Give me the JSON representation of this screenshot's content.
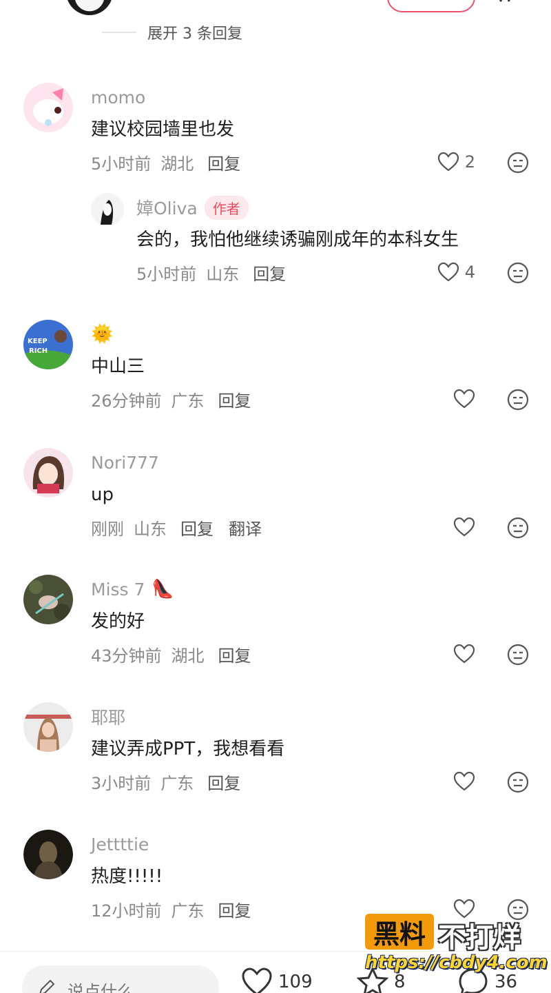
{
  "header": {
    "expand_replies": "展开 3 条回复"
  },
  "comments": [
    {
      "name": "momo",
      "text": "建议校园墙里也发",
      "time": "5小时前",
      "region": "湖北",
      "reply": "回复",
      "likes": "2"
    },
    {
      "name": "嫜Oliva",
      "author_tag": "作者",
      "text": "会的，我怕他继续诱骗刚成年的本科女生",
      "time": "5小时前",
      "region": "山东",
      "reply": "回复",
      "likes": "4"
    },
    {
      "name_emoji": "🌞",
      "text": "中山三",
      "time": "26分钟前",
      "region": "广东",
      "reply": "回复"
    },
    {
      "name": "Nori777",
      "text": "up",
      "time": "刚刚",
      "region": "山东",
      "reply": "回复",
      "translate": "翻译"
    },
    {
      "name": "Miss 7",
      "name_emoji": "👠",
      "text": "发的好",
      "time": "43分钟前",
      "region": "湖北",
      "reply": "回复"
    },
    {
      "name": "耶耶",
      "text": "建议弄成PPT，我想看看",
      "time": "3小时前",
      "region": "广东",
      "reply": "回复"
    },
    {
      "name": "Jettttie",
      "text": "热度!!!!!",
      "time": "12小时前",
      "region": "广东",
      "reply": "回复"
    }
  ],
  "watermark": {
    "brand": "黑料",
    "side": "不打烊",
    "url": "https://cbdy4.com"
  },
  "bottom_bar": {
    "placeholder": "说点什么...",
    "likes": "109",
    "stars": "8",
    "comments": "36"
  },
  "colors": {
    "accent": "#f0506e",
    "author_tag_bg": "#fde8eb",
    "watermark_orange": "#f39a0b"
  }
}
